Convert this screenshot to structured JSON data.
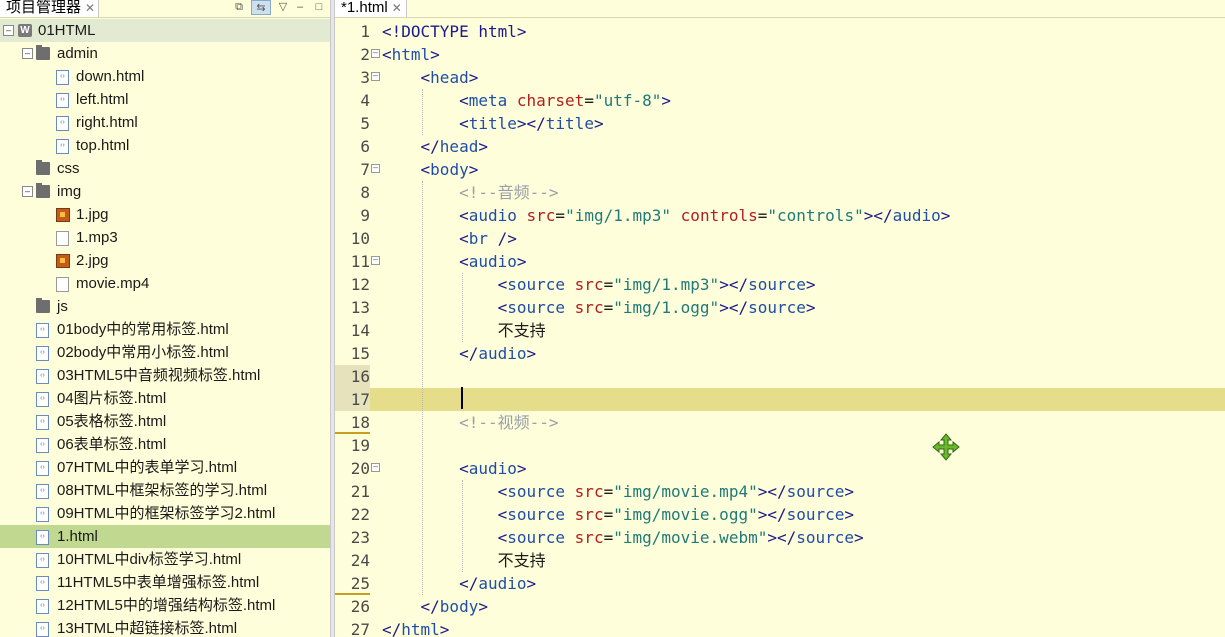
{
  "explorer": {
    "tab_label": "项目管理器",
    "project": "01HTML",
    "items": [
      {
        "label": "admin",
        "kind": "folder",
        "depth": 1,
        "expanded": true
      },
      {
        "label": "down.html",
        "kind": "html",
        "depth": 2
      },
      {
        "label": "left.html",
        "kind": "html",
        "depth": 2
      },
      {
        "label": "right.html",
        "kind": "html",
        "depth": 2
      },
      {
        "label": "top.html",
        "kind": "html",
        "depth": 2
      },
      {
        "label": "css",
        "kind": "folder",
        "depth": 1
      },
      {
        "label": "img",
        "kind": "folder",
        "depth": 1,
        "expanded": true
      },
      {
        "label": "1.jpg",
        "kind": "image",
        "depth": 2
      },
      {
        "label": "1.mp3",
        "kind": "file",
        "depth": 2
      },
      {
        "label": "2.jpg",
        "kind": "image",
        "depth": 2
      },
      {
        "label": "movie.mp4",
        "kind": "file",
        "depth": 2
      },
      {
        "label": "js",
        "kind": "folder",
        "depth": 1
      },
      {
        "label": "01body中的常用标签.html",
        "kind": "html",
        "depth": 1
      },
      {
        "label": "02body中常用小标签.html",
        "kind": "html",
        "depth": 1
      },
      {
        "label": "03HTML5中音频视频标签.html",
        "kind": "html",
        "depth": 1
      },
      {
        "label": "04图片标签.html",
        "kind": "html",
        "depth": 1
      },
      {
        "label": "05表格标签.html",
        "kind": "html",
        "depth": 1
      },
      {
        "label": "06表单标签.html",
        "kind": "html",
        "depth": 1
      },
      {
        "label": "07HTML中的表单学习.html",
        "kind": "html",
        "depth": 1
      },
      {
        "label": "08HTML中框架标签的学习.html",
        "kind": "html",
        "depth": 1
      },
      {
        "label": "09HTML中的框架标签学习2.html",
        "kind": "html",
        "depth": 1
      },
      {
        "label": "1.html",
        "kind": "html",
        "depth": 1,
        "selected": true
      },
      {
        "label": "10HTML中div标签学习.html",
        "kind": "html",
        "depth": 1
      },
      {
        "label": "11HTML5中表单增强标签.html",
        "kind": "html",
        "depth": 1
      },
      {
        "label": "12HTML5中的增强结构标签.html",
        "kind": "html",
        "depth": 1
      },
      {
        "label": "13HTML中超链接标签.html",
        "kind": "html",
        "depth": 1
      }
    ]
  },
  "editor": {
    "tab_label": "*1.html",
    "current_line": 17,
    "lines": [
      [
        [
          "dt",
          "<!DOCTYPE html>"
        ]
      ],
      [
        [
          "t",
          "<"
        ],
        [
          "tn",
          "html"
        ],
        [
          "t",
          ">"
        ]
      ],
      [
        [
          "tx",
          "    "
        ],
        [
          "t",
          "<"
        ],
        [
          "tn",
          "head"
        ],
        [
          "t",
          ">"
        ]
      ],
      [
        [
          "tx",
          "        "
        ],
        [
          "t",
          "<"
        ],
        [
          "tn",
          "meta"
        ],
        [
          "tx",
          " "
        ],
        [
          "an",
          "charset"
        ],
        [
          "tx",
          "="
        ],
        [
          "av",
          "\"utf-8\""
        ],
        [
          "t",
          ">"
        ]
      ],
      [
        [
          "tx",
          "        "
        ],
        [
          "t",
          "<"
        ],
        [
          "tn",
          "title"
        ],
        [
          "t",
          "></"
        ],
        [
          "tn",
          "title"
        ],
        [
          "t",
          ">"
        ]
      ],
      [
        [
          "tx",
          "    "
        ],
        [
          "t",
          "</"
        ],
        [
          "tn",
          "head"
        ],
        [
          "t",
          ">"
        ]
      ],
      [
        [
          "tx",
          "    "
        ],
        [
          "t",
          "<"
        ],
        [
          "tn",
          "body"
        ],
        [
          "t",
          ">"
        ]
      ],
      [
        [
          "tx",
          "        "
        ],
        [
          "cm",
          "<!--音频-->"
        ]
      ],
      [
        [
          "tx",
          "        "
        ],
        [
          "t",
          "<"
        ],
        [
          "tn",
          "audio"
        ],
        [
          "tx",
          " "
        ],
        [
          "an",
          "src"
        ],
        [
          "tx",
          "="
        ],
        [
          "av",
          "\"img/1.mp3\""
        ],
        [
          "tx",
          " "
        ],
        [
          "an",
          "controls"
        ],
        [
          "tx",
          "="
        ],
        [
          "av",
          "\"controls\""
        ],
        [
          "t",
          "></"
        ],
        [
          "tn",
          "audio"
        ],
        [
          "t",
          ">"
        ]
      ],
      [
        [
          "tx",
          "        "
        ],
        [
          "t",
          "<"
        ],
        [
          "tn",
          "br"
        ],
        [
          "t",
          " />"
        ]
      ],
      [
        [
          "tx",
          "        "
        ],
        [
          "t",
          "<"
        ],
        [
          "tn",
          "audio"
        ],
        [
          "t",
          ">"
        ]
      ],
      [
        [
          "tx",
          "            "
        ],
        [
          "t",
          "<"
        ],
        [
          "tn",
          "source"
        ],
        [
          "tx",
          " "
        ],
        [
          "an",
          "src"
        ],
        [
          "tx",
          "="
        ],
        [
          "av",
          "\"img/1.mp3\""
        ],
        [
          "t",
          "></"
        ],
        [
          "tn",
          "source"
        ],
        [
          "t",
          ">"
        ]
      ],
      [
        [
          "tx",
          "            "
        ],
        [
          "t",
          "<"
        ],
        [
          "tn",
          "source"
        ],
        [
          "tx",
          " "
        ],
        [
          "an",
          "src"
        ],
        [
          "tx",
          "="
        ],
        [
          "av",
          "\"img/1.ogg\""
        ],
        [
          "t",
          "></"
        ],
        [
          "tn",
          "source"
        ],
        [
          "t",
          ">"
        ]
      ],
      [
        [
          "tx",
          "            不支持"
        ]
      ],
      [
        [
          "tx",
          "        "
        ],
        [
          "t",
          "</"
        ],
        [
          "tn",
          "audio"
        ],
        [
          "t",
          ">"
        ]
      ],
      [],
      [],
      [
        [
          "tx",
          "        "
        ],
        [
          "cm",
          "<!--视频-->"
        ]
      ],
      [],
      [
        [
          "tx",
          "        "
        ],
        [
          "t",
          "<"
        ],
        [
          "tn",
          "audio"
        ],
        [
          "t",
          ">"
        ]
      ],
      [
        [
          "tx",
          "            "
        ],
        [
          "t",
          "<"
        ],
        [
          "tn",
          "source"
        ],
        [
          "tx",
          " "
        ],
        [
          "an",
          "src"
        ],
        [
          "tx",
          "="
        ],
        [
          "av",
          "\"img/movie.mp4\""
        ],
        [
          "t",
          "></"
        ],
        [
          "tn",
          "source"
        ],
        [
          "t",
          ">"
        ]
      ],
      [
        [
          "tx",
          "            "
        ],
        [
          "t",
          "<"
        ],
        [
          "tn",
          "source"
        ],
        [
          "tx",
          " "
        ],
        [
          "an",
          "src"
        ],
        [
          "tx",
          "="
        ],
        [
          "av",
          "\"img/movie.ogg\""
        ],
        [
          "t",
          "></"
        ],
        [
          "tn",
          "source"
        ],
        [
          "t",
          ">"
        ]
      ],
      [
        [
          "tx",
          "            "
        ],
        [
          "t",
          "<"
        ],
        [
          "tn",
          "source"
        ],
        [
          "tx",
          " "
        ],
        [
          "an",
          "src"
        ],
        [
          "tx",
          "="
        ],
        [
          "av",
          "\"img/movie.webm\""
        ],
        [
          "t",
          "></"
        ],
        [
          "tn",
          "source"
        ],
        [
          "t",
          ">"
        ]
      ],
      [
        [
          "tx",
          "            不支持"
        ]
      ],
      [
        [
          "tx",
          "        "
        ],
        [
          "t",
          "</"
        ],
        [
          "tn",
          "audio"
        ],
        [
          "t",
          ">"
        ]
      ],
      [
        [
          "tx",
          "    "
        ],
        [
          "t",
          "</"
        ],
        [
          "tn",
          "body"
        ],
        [
          "t",
          ">"
        ]
      ],
      [
        [
          "t",
          "</"
        ],
        [
          "tn",
          "html"
        ],
        [
          "t",
          ">"
        ]
      ]
    ],
    "fold_lines": [
      2,
      3,
      7,
      11,
      20
    ],
    "highlight_numbers": [
      16,
      17
    ],
    "underline_numbers": [
      18,
      25
    ]
  },
  "colors": {
    "background": "#fefeda",
    "current_line": "#e6dd8a",
    "selection": "#c0d890",
    "move_icon": "#5aa020"
  }
}
